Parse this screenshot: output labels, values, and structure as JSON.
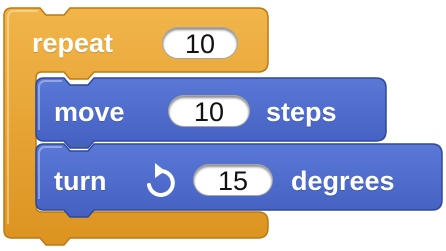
{
  "colors": {
    "control_block": "#E6A230",
    "control_block_dark": "#B97A12",
    "motion_block": "#4A68C8",
    "motion_block_dark": "#2F4898",
    "text": "#FFFFFF",
    "slot_bg": "#FFFFFF"
  },
  "repeat_block": {
    "label": "repeat",
    "count": "10"
  },
  "move_block": {
    "label": "move",
    "steps_value": "10",
    "suffix": "steps"
  },
  "turn_block": {
    "label": "turn",
    "icon": "rotate-clockwise-icon",
    "degrees_value": "15",
    "suffix": "degrees"
  }
}
